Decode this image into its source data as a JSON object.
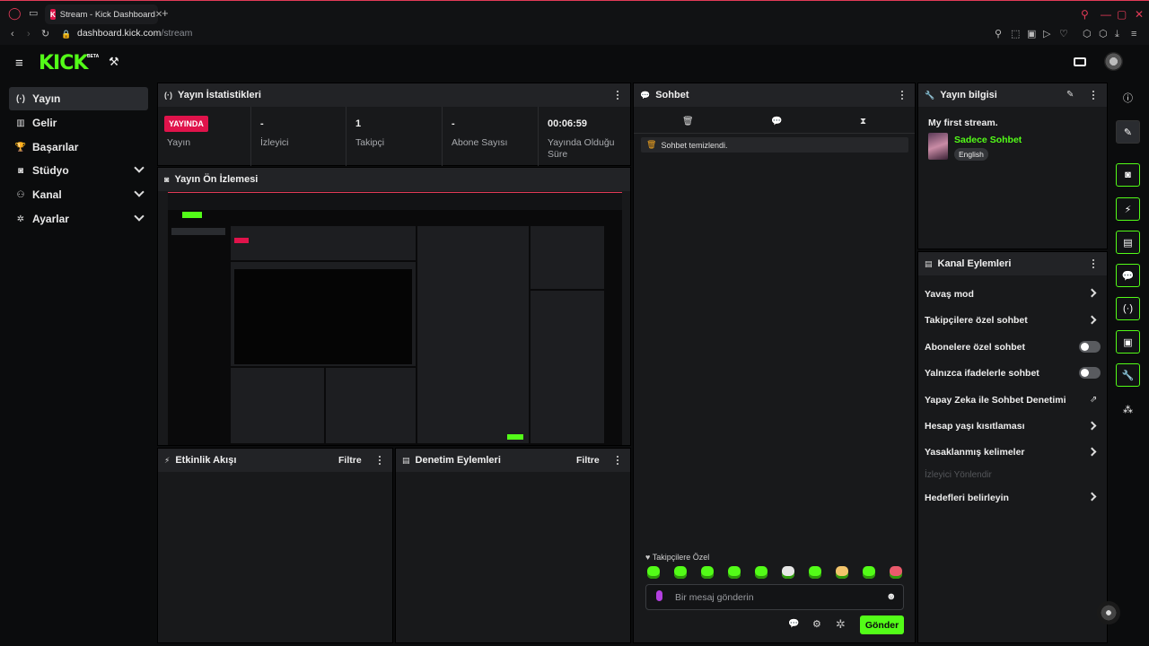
{
  "browser": {
    "tab_title": "Stream - Kick Dashboard",
    "tab_favicon": "K",
    "url_host": "dashboard.kick.com",
    "url_path": "/stream"
  },
  "header": {
    "logo": "KICK",
    "beta": "BETA"
  },
  "sidebar": {
    "items": [
      {
        "label": "Yayın",
        "icon": "broadcast-icon",
        "glyph": "(·)"
      },
      {
        "label": "Gelir",
        "icon": "revenue-icon",
        "glyph": "▥"
      },
      {
        "label": "Başarılar",
        "icon": "trophy-icon",
        "glyph": "🏆"
      },
      {
        "label": "Stüdyo",
        "icon": "studio-icon",
        "glyph": "◙"
      },
      {
        "label": "Kanal",
        "icon": "channel-icon",
        "glyph": "⚇"
      },
      {
        "label": "Ayarlar",
        "icon": "settings-icon",
        "glyph": "✲"
      }
    ]
  },
  "stats_panel": {
    "title": "Yayın İstatistikleri",
    "live_badge": "YAYINDA",
    "stats": [
      {
        "value": "",
        "label": "Yayın"
      },
      {
        "value": "-",
        "label": "İzleyici"
      },
      {
        "value": "1",
        "label": "Takipçi"
      },
      {
        "value": "-",
        "label": "Abone Sayısı"
      },
      {
        "value": "00:06:59",
        "label": "Yayında Olduğu Süre"
      }
    ]
  },
  "preview_panel": {
    "title": "Yayın Ön İzlemesi"
  },
  "activity_panel": {
    "title": "Etkinlik Akışı",
    "filter": "Filtre"
  },
  "moderation_panel": {
    "title": "Denetim Eylemleri",
    "filter": "Filtre"
  },
  "chat_panel": {
    "title": "Sohbet",
    "system_message": "Sohbet temizlendi.",
    "followers_only": "Takipçilere Özel",
    "input_placeholder": "Bir mesaj gönderin",
    "send_label": "Gönder"
  },
  "stream_info_panel": {
    "title": "Yayın bilgisi",
    "stream_title": "My first stream.",
    "category": "Sadece Sohbet",
    "language": "English"
  },
  "channel_actions_panel": {
    "title": "Kanal Eylemleri",
    "actions": [
      {
        "label": "Yavaş mod",
        "control": "arrow"
      },
      {
        "label": "Takipçilere özel sohbet",
        "control": "arrow"
      },
      {
        "label": "Abonelere özel sohbet",
        "control": "toggle",
        "enabled": false
      },
      {
        "label": "Yalnızca ifadelerle sohbet",
        "control": "toggle",
        "enabled": false
      },
      {
        "label": "Yapay Zeka ile Sohbet Denetimi",
        "control": "external"
      },
      {
        "label": "Hesap yaşı kısıtlaması",
        "control": "arrow"
      },
      {
        "label": "Yasaklanmış kelimeler",
        "control": "arrow"
      },
      {
        "label": "İzleyici Yönlendir",
        "control": "disabled"
      },
      {
        "label": "Hedefleri belirleyin",
        "control": "arrow"
      }
    ]
  },
  "colors": {
    "brand_green": "#53fc18",
    "live_red": "#e0134b",
    "browser_accent": "#e23a57"
  }
}
